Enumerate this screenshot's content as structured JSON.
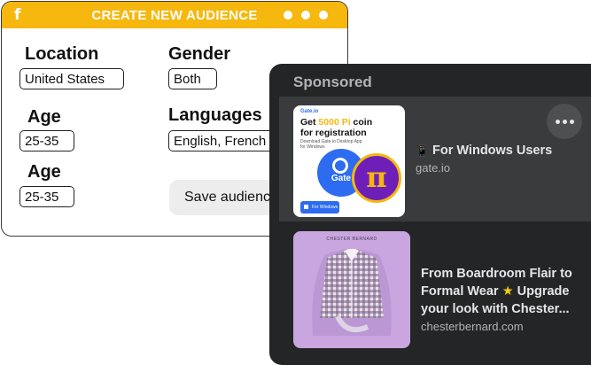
{
  "audience_form": {
    "header": {
      "icon": "f",
      "title": "CREATE NEW AUDIENCE"
    },
    "location": {
      "label": "Location",
      "value": "United States"
    },
    "gender": {
      "label": "Gender",
      "value": "Both"
    },
    "age_1": {
      "label": "Age",
      "value": "25-35"
    },
    "languages": {
      "label": "Languages",
      "value": "English, French"
    },
    "age_2": {
      "label": "Age",
      "value": "25-35"
    },
    "save_label": "Save audience"
  },
  "sponsored": {
    "title": "Sponsored",
    "ads": [
      {
        "headline_icon": "📱",
        "headline": "For Windows Users",
        "domain": "gate.io",
        "thumbnail": {
          "brand": "Gate.io",
          "line1_pre": "Get ",
          "line1_hl": "5000 Pi",
          "line1_post": " coin",
          "line2": "for registration",
          "sub": "Download Gate.io Desktop App for Windows",
          "logo_text": "Gate",
          "pi_symbol": "π",
          "button": "For Windows",
          "accent_yellow": "#f6b70f",
          "accent_blue": "#2d6cf0",
          "accent_purple": "#6e1fb8"
        }
      },
      {
        "headline_line1": "From Boardroom Flair to",
        "headline_line2_pre": "Formal Wear ",
        "headline_star": "★",
        "headline_line2_post": " Upgrade",
        "headline_line3": "your look with Chester...",
        "domain": "chesterbernard.com",
        "thumbnail": {
          "brand": "CHESTER BERNARD",
          "bg_color": "#c9a6e0"
        }
      }
    ]
  },
  "colors": {
    "header_yellow": "#f6b70f",
    "panel_bg": "#242526",
    "row_hover": "#3a3b3c",
    "text_light": "#e4e6eb",
    "text_muted": "#b0b3b8"
  }
}
